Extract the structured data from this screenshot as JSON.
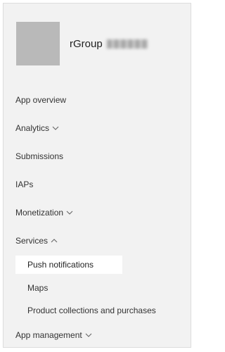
{
  "app": {
    "name": "rGroup",
    "name_suffix_redacted": true
  },
  "nav": {
    "items": [
      {
        "label": "App overview",
        "expandable": false
      },
      {
        "label": "Analytics",
        "expandable": true,
        "expanded": false
      },
      {
        "label": "Submissions",
        "expandable": false
      },
      {
        "label": "IAPs",
        "expandable": false
      },
      {
        "label": "Monetization",
        "expandable": true,
        "expanded": false
      },
      {
        "label": "Services",
        "expandable": true,
        "expanded": true
      },
      {
        "label": "App management",
        "expandable": true,
        "expanded": false
      }
    ],
    "services_children": [
      {
        "label": "Push notifications",
        "selected": true
      },
      {
        "label": "Maps",
        "selected": false
      },
      {
        "label": "Product collections and purchases",
        "selected": false
      }
    ]
  },
  "colors": {
    "panel_bg": "#f2f2f2",
    "selected_bg": "#ffffff",
    "avatar_bg": "#b9b9b9",
    "text": "#333333"
  }
}
